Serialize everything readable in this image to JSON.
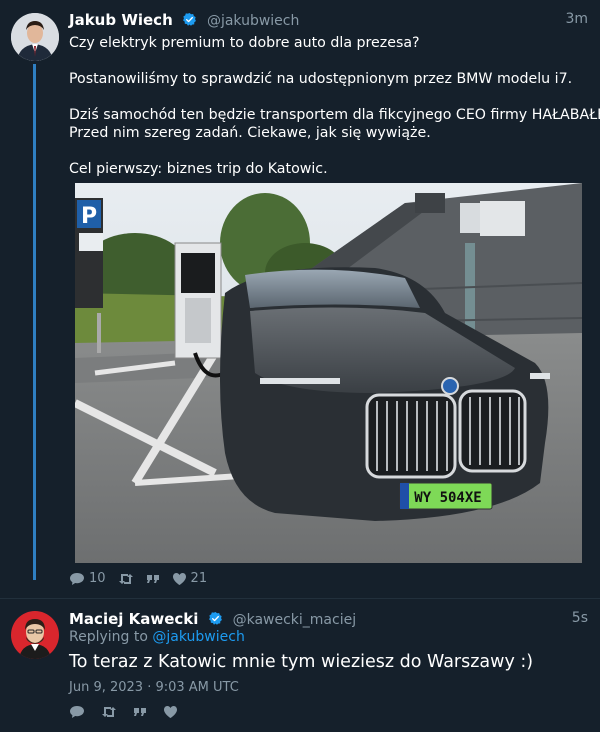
{
  "tweet1": {
    "name": "Jakub Wiech",
    "handle": "@jakubwiech",
    "time": "3m",
    "lines": [
      "Czy elektryk premium to dobre auto dla prezesa?",
      "Postanowiliśmy to sprawdzić na udostępnionym przez BMW modelu i7.",
      "Dziś samochód ten będzie transportem dla fikcyjnego CEO firmy HAŁABAŁEX.",
      "Przed nim szereg zadań. Ciekawe, jak się wywiąże.",
      "Cel pierwszy: biznes trip do Katowic."
    ],
    "photo": {
      "plate": "WY 504XE",
      "sign": "P"
    },
    "replies": "10",
    "likes": "21"
  },
  "tweet2": {
    "name": "Maciej Kawecki",
    "handle": "@kawecki_maciej",
    "time": "5s",
    "replying_prefix": "Replying to ",
    "replying_to": "@jakubwiech",
    "text": "To teraz z Katowic mnie tym wieziesz do Warszawy :)",
    "timestamp": "Jun 9, 2023 · 9:03 AM UTC"
  },
  "colors": {
    "background": "#15202b",
    "accent": "#1d9bf0",
    "muted": "#8899a6"
  },
  "icons": [
    "verified-badge-icon",
    "reply-icon",
    "retweet-icon",
    "quote-icon",
    "like-icon"
  ]
}
